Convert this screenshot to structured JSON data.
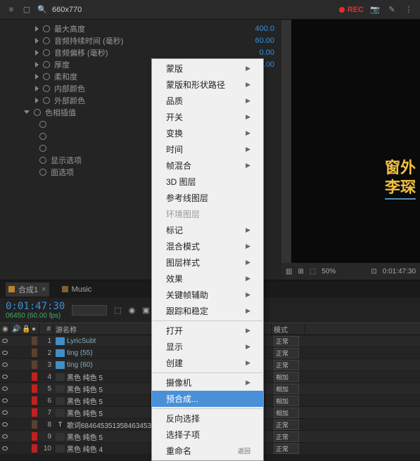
{
  "topbar": {
    "search_value": "660x770",
    "rec_label": "REC"
  },
  "props": {
    "items": [
      {
        "indent": 1,
        "icon": ">",
        "sw": true,
        "name": "最大高度",
        "val": "400.0"
      },
      {
        "indent": 1,
        "icon": ">",
        "sw": true,
        "name": "音频持续时间 (毫秒)",
        "val": "60.00"
      },
      {
        "indent": 1,
        "icon": ">",
        "sw": true,
        "name": "音频偏移 (毫秒)",
        "val": "0.00"
      },
      {
        "indent": 1,
        "icon": ">",
        "sw": true,
        "name": "厚度",
        "val": "2.00"
      },
      {
        "indent": 1,
        "icon": ">",
        "sw": true,
        "name": "柔和度",
        "val": ""
      },
      {
        "indent": 1,
        "icon": ">",
        "sw": true,
        "name": "内部颜色",
        "val": ""
      },
      {
        "indent": 1,
        "icon": ">",
        "sw": true,
        "name": "外部颜色",
        "val": ""
      },
      {
        "indent": 0,
        "icon": "v",
        "sw": true,
        "name": "色相插值",
        "val": ""
      },
      {
        "indent": 1,
        "icon": "",
        "sw": true,
        "name": "",
        "val": ""
      },
      {
        "indent": 1,
        "icon": "",
        "sw": true,
        "name": "",
        "val": ""
      },
      {
        "indent": 1,
        "icon": "",
        "sw": true,
        "name": "",
        "val": ""
      },
      {
        "indent": 1,
        "icon": "",
        "sw": true,
        "name": "显示选项",
        "val": ""
      },
      {
        "indent": 1,
        "icon": "",
        "sw": true,
        "name": "面选项",
        "val": ""
      }
    ]
  },
  "preview": {
    "line1": "窗外",
    "line2": "李琛",
    "zoom": "50%",
    "timecode": "0:01:47:30"
  },
  "tabs": {
    "t1": "合成1",
    "t2": "Music"
  },
  "timeline": {
    "timecode": "0:01:47:30",
    "fps": "06450 (60.00 fps)",
    "search_ph": ""
  },
  "headers": {
    "source": "源名称",
    "switches": "亜☆\\fx图◎◎◎",
    "mode": "模式"
  },
  "layers": [
    {
      "n": "1",
      "color": "#5a4030",
      "icon": "comp",
      "name": "LyricSubt",
      "sw": "亜",
      "fx": "",
      "mode": "正常"
    },
    {
      "n": "2",
      "color": "#5a4030",
      "icon": "comp",
      "name": "ting (55)",
      "sw": "亜",
      "fx": "",
      "mode": "正常"
    },
    {
      "n": "3",
      "color": "#5a4030",
      "icon": "comp",
      "name": "ting (60)",
      "sw": "亜",
      "fx": "",
      "mode": "正常"
    },
    {
      "n": "4",
      "color": "#c02020",
      "icon": "solid",
      "name": "黑色 纯色 5",
      "sw": "亜",
      "fx": "/ fx",
      "mode": "相加"
    },
    {
      "n": "5",
      "color": "#c02020",
      "icon": "solid",
      "name": "黑色 纯色 5",
      "sw": "亜",
      "fx": "/ fx",
      "mode": "相加"
    },
    {
      "n": "6",
      "color": "#c02020",
      "icon": "solid",
      "name": "黑色 纯色 5",
      "sw": "亜",
      "fx": "/ fx",
      "mode": "相加"
    },
    {
      "n": "7",
      "color": "#c02020",
      "icon": "solid",
      "name": "黑色 纯色 5",
      "sw": "亜",
      "fx": "/ fx",
      "mode": "相加"
    },
    {
      "n": "8",
      "color": "#5a4030",
      "icon": "t",
      "name": "歌词6846453513584634534831351位置",
      "sw": "亜☆",
      "fx": "/ fx",
      "mode": "正常"
    },
    {
      "n": "9",
      "color": "#c02020",
      "icon": "solid",
      "name": "黑色 纯色 5",
      "sw": "亜",
      "fx": "",
      "mode": "正常"
    },
    {
      "n": "10",
      "color": "#c02020",
      "icon": "solid",
      "name": "黑色 纯色 4",
      "sw": "亜",
      "fx": "",
      "mode": "正常"
    }
  ],
  "menu": {
    "groups": [
      [
        {
          "l": "蒙版",
          "s": true
        },
        {
          "l": "蒙版和形状路径",
          "s": true
        },
        {
          "l": "品质",
          "s": true
        },
        {
          "l": "开关",
          "s": true
        },
        {
          "l": "变换",
          "s": true
        },
        {
          "l": "时间",
          "s": true
        },
        {
          "l": "帧混合",
          "s": true
        },
        {
          "l": "3D 图层",
          "s": false
        },
        {
          "l": "参考线图层",
          "s": false
        },
        {
          "l": "环境图层",
          "s": false,
          "d": true
        },
        {
          "l": "标记",
          "s": true
        },
        {
          "l": "混合模式",
          "s": true
        },
        {
          "l": "图层样式",
          "s": true
        },
        {
          "l": "效果",
          "s": true
        },
        {
          "l": "关键帧辅助",
          "s": true
        },
        {
          "l": "跟踪和稳定",
          "s": true
        }
      ],
      [
        {
          "l": "打开",
          "s": true
        },
        {
          "l": "显示",
          "s": true
        },
        {
          "l": "创建",
          "s": true
        }
      ],
      [
        {
          "l": "摄像机",
          "s": true
        },
        {
          "l": "预合成...",
          "s": false,
          "h": true
        }
      ],
      [
        {
          "l": "反向选择",
          "s": false
        },
        {
          "l": "选择子项",
          "s": false
        },
        {
          "l": "重命名",
          "s": false,
          "r": "返回"
        }
      ]
    ]
  }
}
